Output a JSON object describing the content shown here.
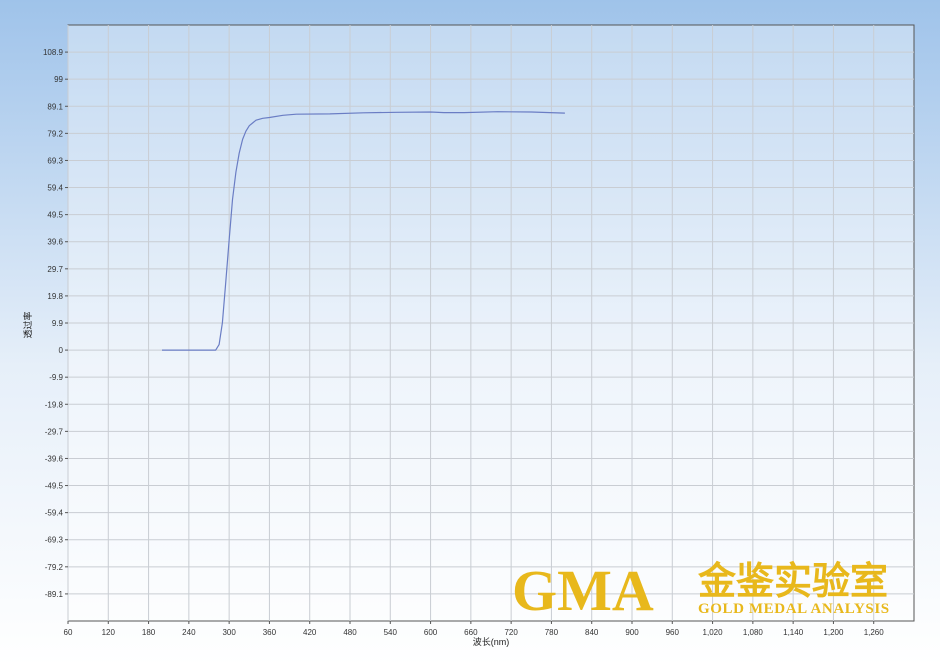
{
  "chart_data": {
    "type": "line",
    "title": "",
    "xlabel": "波长(nm)",
    "ylabel": "透过率",
    "xlim": [
      60,
      1320
    ],
    "ylim": [
      -99,
      118.8
    ],
    "xticks": [
      "60",
      "120",
      "180",
      "240",
      "300",
      "360",
      "420",
      "480",
      "540",
      "600",
      "660",
      "720",
      "780",
      "840",
      "900",
      "960",
      "1,020",
      "1,080",
      "1,140",
      "1,200",
      "1,260"
    ],
    "yticks": [
      "108.9",
      "99",
      "89.1",
      "79.2",
      "69.3",
      "59.4",
      "49.5",
      "39.6",
      "29.7",
      "19.8",
      "9.9",
      "0",
      "-9.9",
      "-19.8",
      "-29.7",
      "-39.6",
      "-49.5",
      "-59.4",
      "-69.3",
      "-79.2",
      "-89.1"
    ],
    "grid": true,
    "series": [
      {
        "x": [
          200,
          250,
          280,
          285,
          290,
          295,
          300,
          305,
          310,
          315,
          320,
          325,
          330,
          335,
          340,
          350,
          360,
          380,
          400,
          450,
          500,
          550,
          600,
          620,
          650,
          700,
          750,
          800
        ],
        "y": [
          0,
          0,
          0,
          2,
          10,
          25,
          40,
          55,
          65,
          72,
          77,
          80,
          82,
          83,
          84,
          84.7,
          85,
          85.8,
          86.2,
          86.3,
          86.7,
          86.9,
          87.0,
          86.8,
          86.8,
          87.1,
          87.0,
          86.6
        ]
      }
    ]
  },
  "colors": {
    "series": "#6a7dc4",
    "background_top": "#9fc3ea",
    "background_bottom": "#ffffff",
    "plot_frame": "#555555",
    "watermark": "#e8b81c"
  },
  "watermark": {
    "logo": "GMA",
    "chinese": "金鉴实验室",
    "english": "GOLD MEDAL ANALYSIS"
  }
}
